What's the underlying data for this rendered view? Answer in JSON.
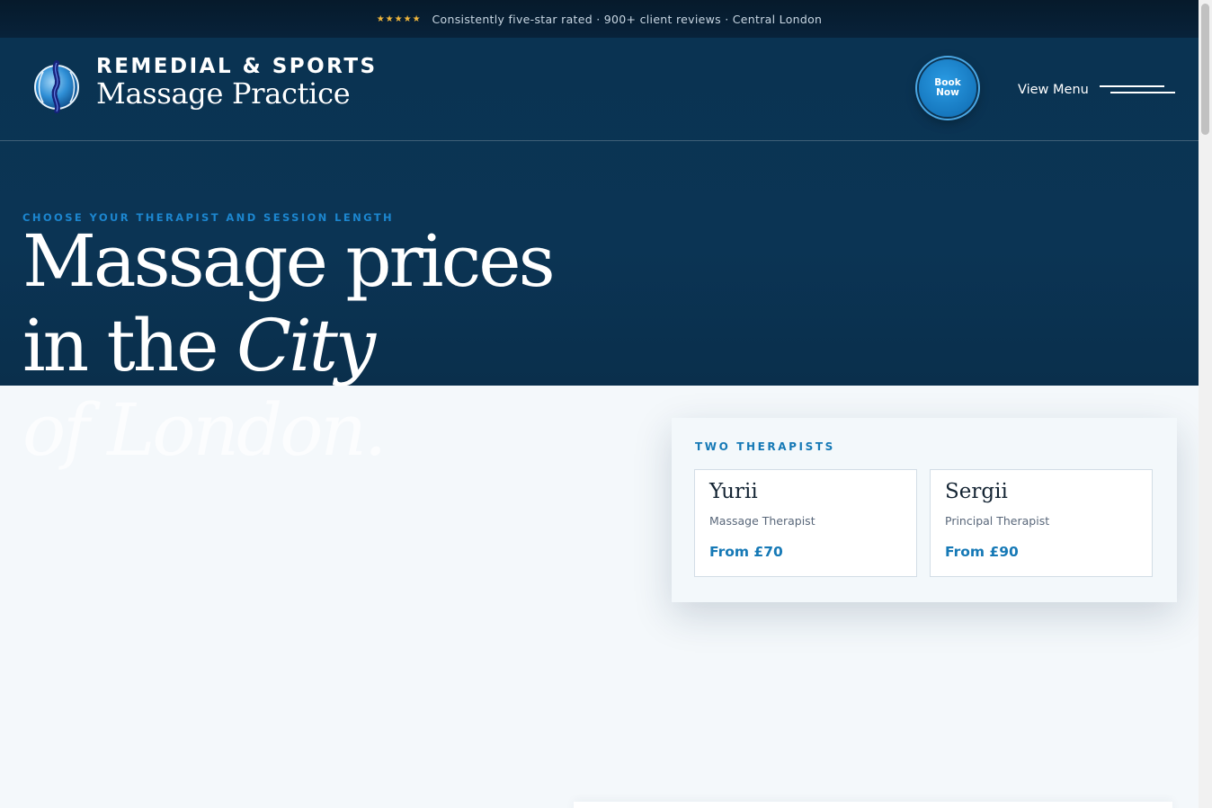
{
  "topbar": {
    "stars": "★★★★★",
    "text": "Consistently five-star rated · 900+ client reviews · Central London"
  },
  "brand": {
    "line1": "REMEDIAL & SPORTS",
    "line2": "Massage Practice",
    "logo_icon": "spine-globe-icon"
  },
  "nav": {
    "book_line1": "Book",
    "book_line2": "Now",
    "menu_label": "View Menu",
    "menu_icon": "hamburger-icon"
  },
  "hero": {
    "eyebrow": "CHOOSE YOUR THERAPIST AND SESSION LENGTH",
    "headline_line1": "Massage prices",
    "headline_line2_a": "in the ",
    "headline_line2_b": "City",
    "headline_line3": "of London."
  },
  "therapists": {
    "title": "TWO THERAPISTS",
    "items": [
      {
        "name": "Yurii",
        "role": "Massage Therapist",
        "price": "From £70"
      },
      {
        "name": "Sergii",
        "role": "Principal Therapist",
        "price": "From £90"
      }
    ]
  },
  "colors": {
    "navy": "#0b3454",
    "accent": "#1679b6",
    "star": "#f0b63c",
    "light_bg": "#f4f8fb"
  }
}
